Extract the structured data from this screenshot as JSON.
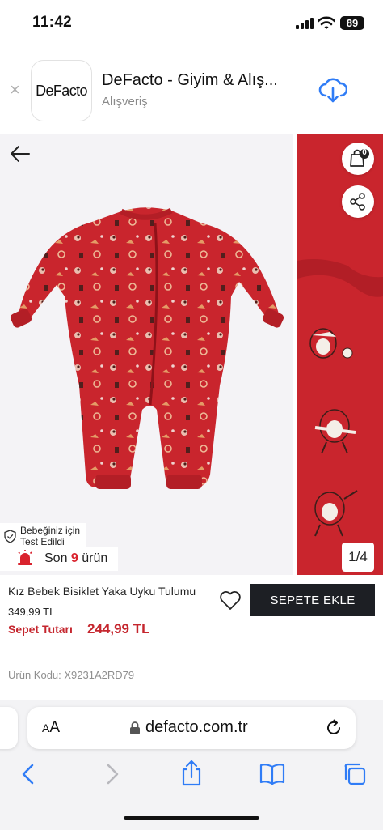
{
  "status_bar": {
    "time": "11:42",
    "battery": "89"
  },
  "app_banner": {
    "logo_text": "DeFacto",
    "app_name": "DeFacto - Giyim & Alış...",
    "category": "Alışveriş",
    "close_symbol": "×",
    "download_icon": "cloud-download-icon"
  },
  "gallery": {
    "cart_count": "0",
    "tested_badge": "Bebeğiniz için Test Edildi",
    "stock_prefix": "Son",
    "stock_count": "9",
    "stock_suffix": "ürün",
    "page_indicator": "1/4"
  },
  "product": {
    "name": "Kız Bebek Bisiklet Yaka Uyku Tulumu",
    "price": "349,99 TL",
    "cart_total_label": "Sepet Tutarı",
    "cart_total_value": "244,99 TL",
    "add_to_cart": "SEPETE EKLE",
    "code": "Ürün Kodu: X9231A2RD79"
  },
  "browser": {
    "aa_small": "A",
    "aa_large": "A",
    "url": "defacto.com.tr"
  },
  "colors": {
    "accent_red": "#c5262e",
    "button_dark": "#1d1f24",
    "link_blue": "#2f7cf6",
    "garment_red": "#c9252d"
  }
}
